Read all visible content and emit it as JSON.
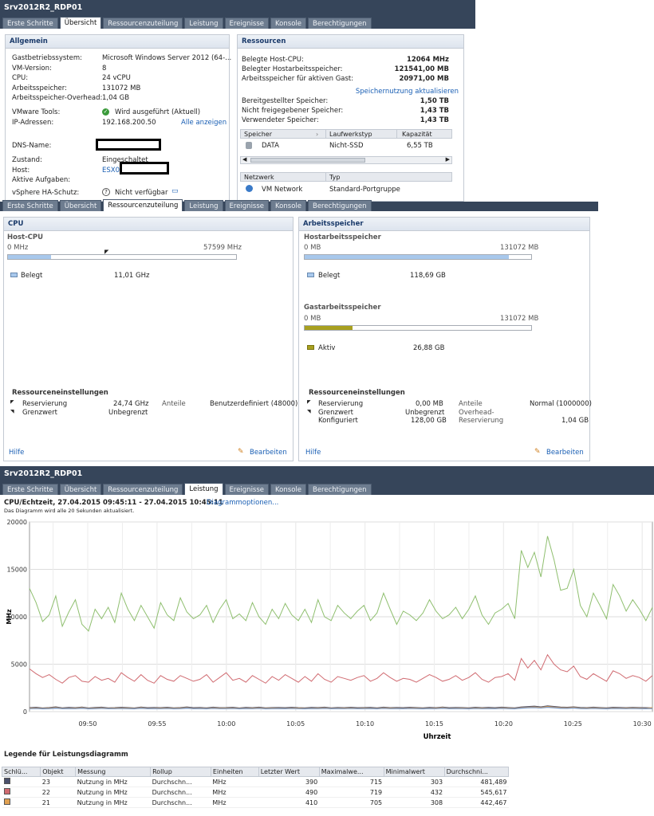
{
  "window_title": "Srv2012R2_RDP01",
  "tabs": [
    "Erste Schritte",
    "Übersicht",
    "Ressourcenzuteilung",
    "Leistung",
    "Ereignisse",
    "Konsole",
    "Berechtigungen"
  ],
  "allgemein": {
    "title": "Allgemein",
    "rows": [
      {
        "label": "Gastbetriebssystem:",
        "value": "Microsoft Windows Server 2012 (64-..."
      },
      {
        "label": "VM-Version:",
        "value": "8"
      },
      {
        "label": "CPU:",
        "value": "24 vCPU"
      },
      {
        "label": "Arbeitsspeicher:",
        "value": "131072 MB"
      },
      {
        "label": "Arbeitsspeicher-Overhead:",
        "value": "1,04 GB"
      }
    ],
    "tools_label": "VMware Tools:",
    "tools_value": "Wird ausgeführt (Aktuell)",
    "ip_label": "IP-Adressen:",
    "ip_value": "192.168.200.50",
    "ip_link": "Alle anzeigen",
    "dns_label": "DNS-Name:",
    "zustand_label": "Zustand:",
    "zustand_value": "Eingeschaltet",
    "host_label": "Host:",
    "host_value": "ESX0",
    "aufgaben_label": "Aktive Aufgaben:",
    "ha_label": "vSphere HA-Schutz:",
    "ha_value": "Nicht verfügbar"
  },
  "ressourcen": {
    "title": "Ressourcen",
    "rows": [
      {
        "label": "Belegte Host-CPU:",
        "value": "12064 MHz"
      },
      {
        "label": "Belegter Hostarbeitsspeicher:",
        "value": "121541,00 MB"
      },
      {
        "label": "Arbeitsspeicher für aktiven Gast:",
        "value": "20971,00 MB"
      }
    ],
    "refresh_link": "Speichernutzung aktualisieren",
    "storage_rows": [
      {
        "label": "Bereitgestellter Speicher:",
        "value": "1,50 TB"
      },
      {
        "label": "Nicht freigegebener Speicher:",
        "value": "1,43 TB"
      },
      {
        "label": "Verwendeter Speicher:",
        "value": "1,43 TB"
      }
    ],
    "ds_headers": [
      "Speicher",
      "Laufwerkstyp",
      "Kapazität"
    ],
    "ds_row": {
      "name": "DATA",
      "type": "Nicht-SSD",
      "capacity": "6,55 TB"
    },
    "net_headers": [
      "Netzwerk",
      "Typ"
    ],
    "net_row": {
      "name": "VM Network",
      "type": "Standard-Portgruppe"
    }
  },
  "cpu_panel": {
    "title": "CPU",
    "host_cpu": "Host-CPU",
    "min": "0 MHz",
    "max": "57599 MHz",
    "usage_fraction": 0.19,
    "belegt_label": "Belegt",
    "belegt_value": "11,01 GHz",
    "settings_title": "Ressourceneinstellungen",
    "reservierung_label": "Reservierung",
    "reservierung_value": "24,74 GHz",
    "grenzwert_label": "Grenzwert",
    "grenzwert_value": "Unbegrenzt",
    "anteile_label": "Anteile",
    "anteile_value": "Benutzerdefiniert (48000)",
    "hilfe": "Hilfe",
    "bearbeiten": "Bearbeiten"
  },
  "mem_panel": {
    "title": "Arbeitsspeicher",
    "host_title": "Hostarbeitsspeicher",
    "host_min": "0 MB",
    "host_max": "131072 MB",
    "host_fraction": 0.9,
    "belegt_label": "Belegt",
    "belegt_value": "118,69 GB",
    "guest_title": "Gastarbeitsspeicher",
    "guest_min": "0 MB",
    "guest_max": "131072 MB",
    "guest_fraction": 0.21,
    "aktiv_label": "Aktiv",
    "aktiv_value": "26,88 GB",
    "settings_title": "Ressourceneinstellungen",
    "reservierung_label": "Reservierung",
    "reservierung_value": "0,00 MB",
    "grenzwert_label": "Grenzwert",
    "grenzwert_value": "Unbegrenzt",
    "konfiguriert_label": "Konfiguriert",
    "konfiguriert_value": "128,00 GB",
    "anteile_label": "Anteile",
    "anteile_value": "Normal (1000000)",
    "overhead_label": "Overhead-",
    "overhead_label2": "Reservierung",
    "overhead_value": "1,04 GB",
    "hilfe": "Hilfe",
    "bearbeiten": "Bearbeiten"
  },
  "perf": {
    "title": "CPU/Echtzeit, 27.04.2015 09:45:11 - 27.04.2015 10:45:11",
    "options_link": "Diagrammoptionen...",
    "subtitle": "Das Diagramm wird alle 20 Sekunden aktualisiert.",
    "legend_title": "Legende für Leistungsdiagramm",
    "legend_headers": [
      "Schlü...",
      "Objekt",
      "Messung",
      "Rollup",
      "Einheiten",
      "Letzter Wert",
      "Maximalwe...",
      "Minimalwert",
      "Durchschni..."
    ],
    "legend_rows": [
      {
        "color": "#4a4f6b",
        "obj": "23",
        "mess": "Nutzung in MHz",
        "rollup": "Durchschn...",
        "unit": "MHz",
        "last": "390",
        "max": "715",
        "min": "303",
        "avg": "481,489"
      },
      {
        "color": "#d06a70",
        "obj": "22",
        "mess": "Nutzung in MHz",
        "rollup": "Durchschn...",
        "unit": "MHz",
        "last": "490",
        "max": "719",
        "min": "432",
        "avg": "545,617"
      },
      {
        "color": "#e0a050",
        "obj": "21",
        "mess": "Nutzung in MHz",
        "rollup": "Durchschn...",
        "unit": "MHz",
        "last": "410",
        "max": "705",
        "min": "308",
        "avg": "442,467"
      }
    ]
  },
  "chart_data": {
    "type": "line",
    "ylabel": "MHz",
    "xlabel": "Uhrzeit",
    "ylim": [
      0,
      20000
    ],
    "yticks": [
      "20000",
      "15000",
      "10000",
      "5000",
      "0"
    ],
    "xticks": [
      "09:50",
      "09:55",
      "10:00",
      "10:05",
      "10:10",
      "10:15",
      "10:20",
      "10:25",
      "10:30"
    ],
    "series": [
      {
        "color": "#8fbf6f",
        "values": [
          13000,
          11500,
          9500,
          10200,
          12200,
          9000,
          10500,
          11800,
          9200,
          8500,
          10800,
          9800,
          11000,
          9400,
          12500,
          10800,
          9600,
          11200,
          10000,
          8800,
          11500,
          10200,
          9600,
          12000,
          10500,
          9800,
          10200,
          11200,
          9400,
          10800,
          11800,
          9800,
          10300,
          9600,
          11500,
          10000,
          9200,
          10800,
          9800,
          11400,
          10200,
          9600,
          10800,
          9400,
          11800,
          10000,
          9600,
          11200,
          10400,
          9800,
          10600,
          11200,
          9600,
          10400,
          12500,
          10800,
          9200,
          10600,
          10200,
          9600,
          10400,
          11800,
          10600,
          9800,
          10200,
          11000,
          9800,
          10800,
          12200,
          10200,
          9200,
          10400,
          10800,
          11400,
          9800,
          17000,
          15200,
          16800,
          14200,
          18500,
          16000,
          12800,
          13000,
          15000,
          11200,
          10000,
          12500,
          11200,
          9800,
          13400,
          12200,
          10600,
          11800,
          10800,
          9600,
          11000
        ]
      },
      {
        "color": "#d06a70",
        "values": [
          4500,
          4000,
          3600,
          3900,
          3400,
          3000,
          3600,
          3800,
          3200,
          3100,
          3700,
          3300,
          3500,
          3100,
          4100,
          3600,
          3200,
          3900,
          3300,
          3000,
          3800,
          3400,
          3200,
          3800,
          3500,
          3200,
          3400,
          3900,
          3100,
          3600,
          4100,
          3300,
          3500,
          3100,
          3800,
          3400,
          3000,
          3700,
          3300,
          3900,
          3500,
          3100,
          3700,
          3200,
          4000,
          3400,
          3100,
          3700,
          3500,
          3300,
          3600,
          3800,
          3200,
          3500,
          4100,
          3600,
          3200,
          3500,
          3400,
          3100,
          3500,
          3900,
          3600,
          3200,
          3400,
          3800,
          3300,
          3600,
          4100,
          3400,
          3100,
          3600,
          3700,
          4000,
          3300,
          5600,
          4600,
          5400,
          4400,
          6000,
          5000,
          4400,
          4200,
          4800,
          3700,
          3400,
          4000,
          3600,
          3200,
          4300,
          4000,
          3500,
          3800,
          3600,
          3200,
          3800
        ]
      },
      {
        "color": "#4a4f6b",
        "values": [
          400,
          450,
          380,
          420,
          500,
          390,
          440,
          410,
          470,
          380,
          430,
          460,
          390,
          410,
          450,
          420,
          380,
          470,
          400,
          430,
          410,
          450,
          390,
          420,
          480,
          400,
          430,
          390,
          460,
          410,
          420,
          450,
          380,
          440,
          410,
          460,
          390,
          420,
          430,
          400,
          450,
          410,
          390,
          440,
          420,
          460,
          390,
          430,
          410,
          450,
          400,
          420,
          440,
          390,
          460,
          410,
          430,
          400,
          450,
          420,
          390,
          440,
          410,
          470,
          400,
          430,
          420,
          390,
          450,
          410,
          440,
          400,
          460,
          420,
          390,
          480,
          520,
          560,
          500,
          600,
          540,
          470,
          450,
          500,
          430,
          410,
          460,
          420,
          390,
          450,
          430,
          410,
          440,
          420,
          400,
          390
        ]
      },
      {
        "color": "#e0a050",
        "values": [
          350,
          380,
          330,
          360,
          420,
          340,
          370,
          350,
          400,
          330,
          360,
          390,
          340,
          350,
          380,
          360,
          330,
          400,
          340,
          370,
          350,
          380,
          340,
          360,
          410,
          340,
          370,
          330,
          390,
          350,
          360,
          380,
          330,
          370,
          350,
          390,
          340,
          360,
          370,
          340,
          380,
          350,
          330,
          370,
          360,
          390,
          340,
          370,
          350,
          380,
          340,
          360,
          370,
          330,
          390,
          350,
          370,
          340,
          380,
          360,
          330,
          370,
          350,
          400,
          340,
          370,
          360,
          330,
          380,
          350,
          370,
          340,
          390,
          360,
          330,
          410,
          450,
          480,
          430,
          520,
          460,
          400,
          390,
          430,
          370,
          350,
          390,
          360,
          330,
          380,
          370,
          350,
          380,
          360,
          340,
          410
        ]
      },
      {
        "color": "#7a9ac8",
        "values": [
          300,
          330,
          290,
          310,
          360,
          300,
          320,
          300,
          350,
          290,
          310,
          340,
          300,
          300,
          330,
          310,
          290,
          350,
          300,
          320,
          300,
          330,
          290,
          310,
          360,
          300,
          320,
          290,
          340,
          300,
          310,
          330,
          290,
          320,
          300,
          340,
          290,
          310,
          320,
          300,
          330,
          300,
          290,
          320,
          310,
          340,
          300,
          320,
          300,
          330,
          300,
          310,
          320,
          290,
          340,
          300,
          320,
          300,
          330,
          310,
          290,
          320,
          300,
          350,
          300,
          320,
          310,
          290,
          330,
          300,
          320,
          300,
          340,
          310,
          290,
          360,
          400,
          420,
          380,
          450,
          400,
          350,
          340,
          380,
          320,
          300,
          340,
          310,
          290,
          330,
          320,
          300,
          330,
          310,
          300,
          320
        ]
      }
    ]
  }
}
